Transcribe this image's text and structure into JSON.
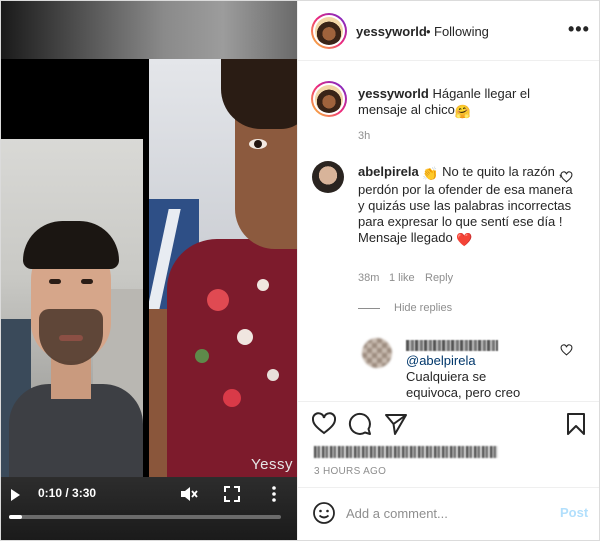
{
  "video": {
    "watermark": "Yessy",
    "time": "0:10 / 3:30",
    "progress": 0.0476
  },
  "header": {
    "username": "yessyworld",
    "separator": "•",
    "follow_status": "Following",
    "more": "•••"
  },
  "caption": {
    "username": "yessyworld",
    "text": "Háganle llegar el mensaje al chico",
    "emoji": "🤗",
    "time": "3h"
  },
  "comment": {
    "username": "abelpirela",
    "emoji_lead": "👏",
    "text": "No te quito la razón , perdón por la ofender de esa manera y quizás use las palabras incorrectas para expresar lo que sentí ese día ! Mensaje llegado",
    "emoji_tail": "❤️",
    "time": "38m",
    "likes": "1 like",
    "reply_label": "Reply",
    "hide_replies": "Hide replies"
  },
  "reply": {
    "mention": "@abelpirela",
    "text": "Cualquiera se equivoca, pero creo que mínimo nos debes"
  },
  "footer": {
    "timestamp": "3 HOURS AGO",
    "comment_placeholder": "Add a comment...",
    "post_label": "Post"
  },
  "colors": {
    "link": "#00376b",
    "muted": "#8e8e8e",
    "post_disabled": "#b2dffc",
    "heart_red": "#ed4956"
  },
  "icons": [
    "play-icon",
    "mute-icon",
    "fullscreen-icon",
    "more-vertical-icon",
    "more-horizontal-icon",
    "heart-icon",
    "comment-icon",
    "share-icon",
    "bookmark-icon",
    "smile-icon"
  ]
}
